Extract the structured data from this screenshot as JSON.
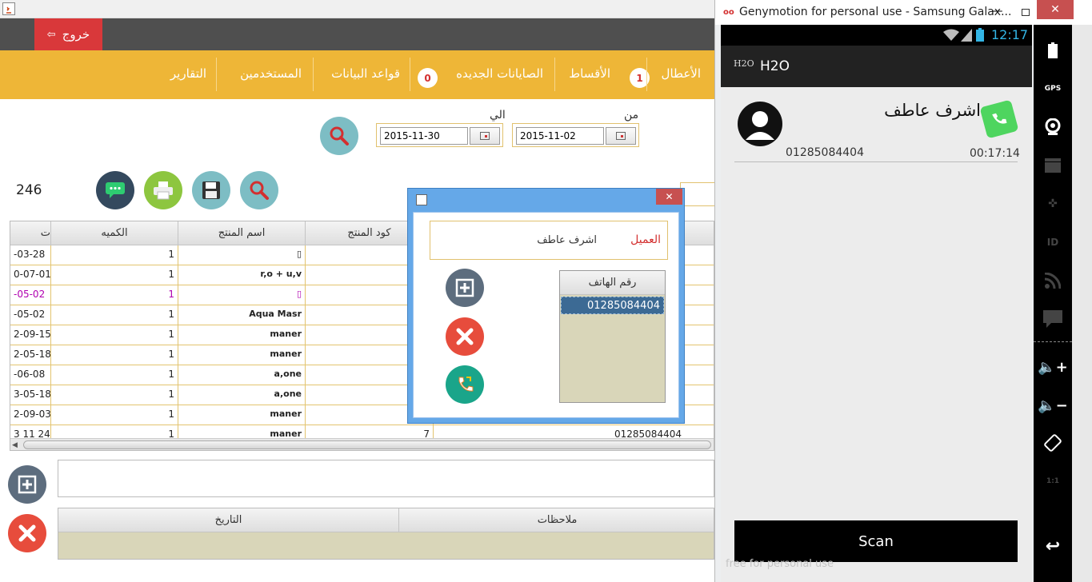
{
  "app": {
    "exit_label": "خروج"
  },
  "nav": {
    "items": [
      {
        "label": "الأعطال",
        "badge": "1"
      },
      {
        "label": "الأقساط"
      },
      {
        "label": "الصايانات الجديده",
        "badge": "0"
      },
      {
        "label": "قواعد البيانات"
      },
      {
        "label": "المستخدمين"
      },
      {
        "label": "التقارير"
      }
    ]
  },
  "filter": {
    "from_label": "من",
    "from_value": "2015-11-02",
    "to_label": "الي",
    "to_value": "2015-11-30"
  },
  "count": "246",
  "table": {
    "headers": [
      "كود المنتج",
      "اسم المنتج",
      "الكميه",
      "ت"
    ],
    "rows": [
      {
        "date": "-03-28",
        "qty": "1",
        "product": "▯",
        "highlight": false
      },
      {
        "date": "0-07-01",
        "qty": "1",
        "product": "r,o + u,v",
        "highlight": false
      },
      {
        "date": "-05-02",
        "qty": "1",
        "product": "▯",
        "highlight": true
      },
      {
        "date": "-05-02",
        "qty": "1",
        "product": "Aqua Masr",
        "highlight": false
      },
      {
        "date": "2-09-15",
        "qty": "1",
        "product": "maner",
        "highlight": false
      },
      {
        "date": "2-05-18",
        "qty": "1",
        "product": "maner",
        "highlight": false
      },
      {
        "date": "-06-08",
        "qty": "1",
        "product": "a,one",
        "highlight": false
      },
      {
        "date": "3-05-18",
        "qty": "1",
        "product": "a,one",
        "highlight": false
      },
      {
        "date": "2-09-03",
        "qty": "1",
        "product": "maner",
        "highlight": false
      }
    ],
    "partial_row": {
      "date": "3 11 24",
      "qty": "1",
      "product": "maner",
      "code": "7",
      "phone": "01285084404"
    }
  },
  "notes_table": {
    "headers": [
      "ملاحظات",
      "التاريخ"
    ]
  },
  "dialog": {
    "customer_label": "العميل",
    "customer_name": "اشرف عاطف",
    "phone_header": "رقم الهاتف",
    "phone_value": "01285084404"
  },
  "emulator": {
    "window_title": "Genymotion for personal use - Samsung Galax...",
    "time": "12:17",
    "app_title": "H2O",
    "app_logo": "H2O",
    "caller_name": "اشرف عاطف",
    "caller_number": "01285084404",
    "call_time": "00:17:14",
    "scan_label": "Scan",
    "watermark": "free for personal use",
    "side_labels": {
      "gps": "GPS",
      "id": "ID",
      "ratio": "1:1"
    }
  },
  "colors": {
    "accent": "#eeb637",
    "exit": "#d9383a",
    "selected": "#3c6a94"
  }
}
